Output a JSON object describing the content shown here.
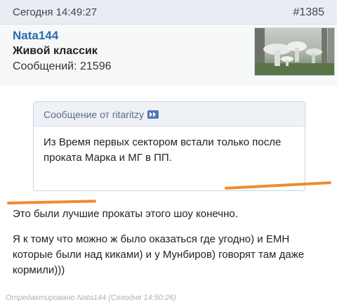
{
  "post": {
    "date": "Сегодня 14:49:27",
    "number": "#1385"
  },
  "author": {
    "username": "Nata144",
    "rank": "Живой классик",
    "post_count": "Сообщений: 21596",
    "avatar_icon": "mushroom-photo-avatar"
  },
  "quote": {
    "author_label": "Сообщение от ritaritzy",
    "jump_icon": "jump-to-post-icon",
    "text": "Из Время первых сектором  встали только после проката Марка и МГ в ПП."
  },
  "message": {
    "line1": "Это были лучшие прокаты этого шоу конечно.",
    "line2": "Я к тому что можно ж было оказаться где угодно) и ЕМН которые были над киками) и у Мунбиров) говорят там даже кормили)))"
  },
  "edited": "Отредактировано Nata144 (Сегодня 14:50:26)",
  "colors": {
    "username": "#2a6aa8",
    "underline": "#f08b30",
    "header_bg": "#e9edf3"
  }
}
